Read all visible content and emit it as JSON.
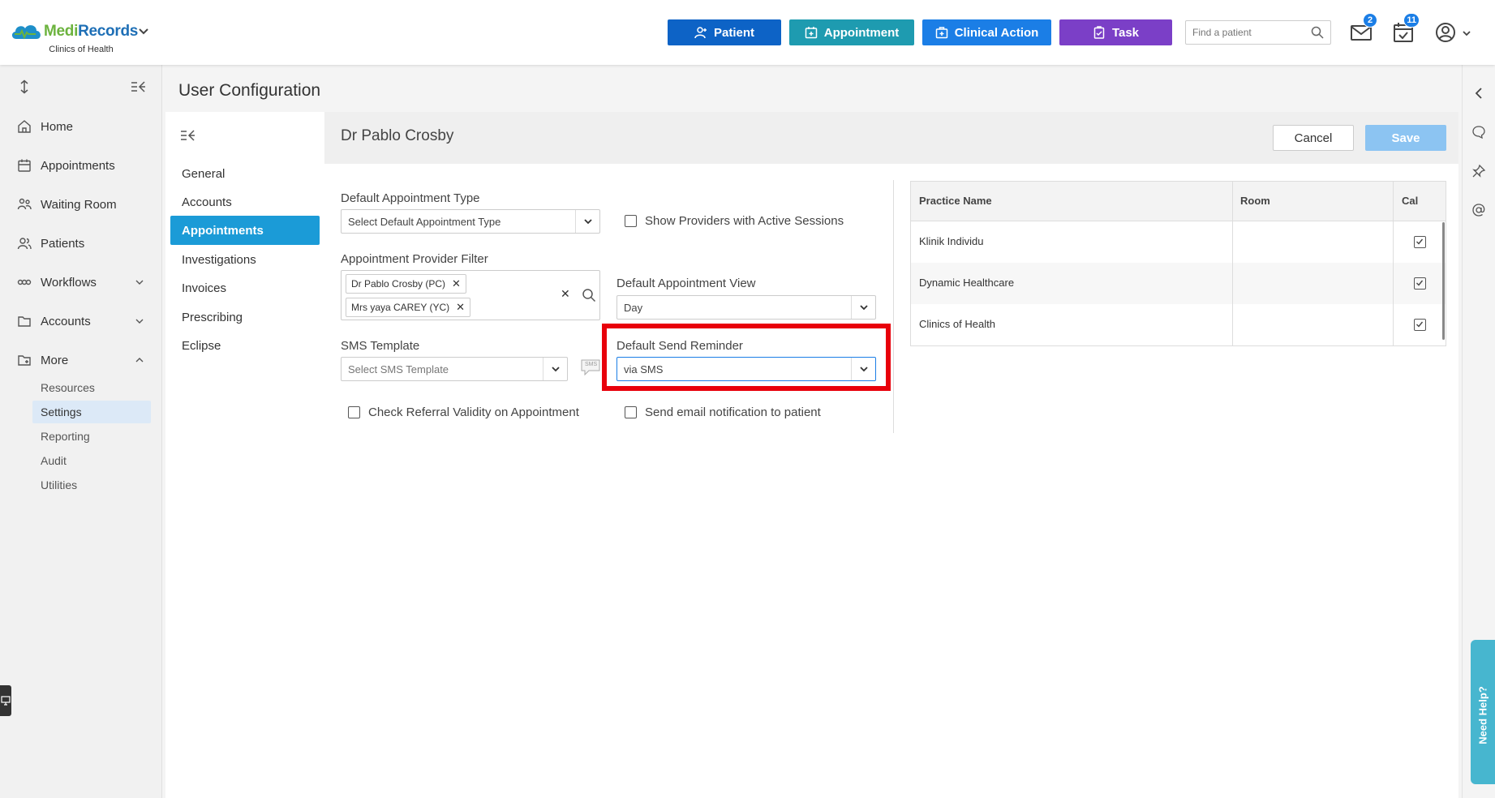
{
  "app": {
    "brand_left": "Medi",
    "brand_right": "Records",
    "practice": "Clinics of Health"
  },
  "topbar": {
    "patient_label": "Patient",
    "appointment_label": "Appointment",
    "clinical_label": "Clinical Action",
    "task_label": "Task",
    "search_placeholder": "Find a patient",
    "mail_count": "2",
    "calendar_count": "11"
  },
  "sidebar": {
    "items": [
      {
        "label": "Home"
      },
      {
        "label": "Appointments"
      },
      {
        "label": "Waiting Room"
      },
      {
        "label": "Patients"
      },
      {
        "label": "Workflows"
      },
      {
        "label": "Accounts"
      },
      {
        "label": "More"
      }
    ],
    "more_sub": [
      "Resources",
      "Settings",
      "Reporting",
      "Audit",
      "Utilities"
    ]
  },
  "page": {
    "title": "User Configuration",
    "subnav": [
      "General",
      "Accounts",
      "Appointments",
      "Investigations",
      "Invoices",
      "Prescribing",
      "Eclipse"
    ]
  },
  "form": {
    "user_name": "Dr Pablo Crosby",
    "cancel_label": "Cancel",
    "save_label": "Save",
    "default_appt_type_label": "Default Appointment Type",
    "default_appt_type_placeholder": "Select Default Appointment Type",
    "show_providers_label": "Show Providers with Active Sessions",
    "provider_filter_label": "Appointment Provider Filter",
    "provider_tags": [
      "Dr Pablo Crosby (PC)",
      "Mrs yaya CAREY (YC)"
    ],
    "default_view_label": "Default Appointment View",
    "default_view_value": "Day",
    "sms_template_label": "SMS Template",
    "sms_template_placeholder": "Select SMS Template",
    "sms_icon_text": "SMS",
    "send_reminder_label": "Default Send Reminder",
    "send_reminder_value": "via SMS",
    "check_referral_label": "Check Referral Validity on Appointment",
    "send_email_label": "Send email notification to patient"
  },
  "table": {
    "headers": [
      "Practice Name",
      "Room",
      "Cal"
    ],
    "rows": [
      {
        "practice": "Klinik Individu",
        "room": "",
        "cal": true
      },
      {
        "practice": "Dynamic Healthcare",
        "room": "",
        "cal": true
      },
      {
        "practice": "Clinics of Health",
        "room": "",
        "cal": true
      }
    ]
  },
  "help": {
    "label": "Need Help?"
  },
  "colors": {
    "primary": "#0d63c6",
    "active_nav": "#1b9bd7",
    "highlight": "#e8000b",
    "task": "#7b3fc7"
  }
}
